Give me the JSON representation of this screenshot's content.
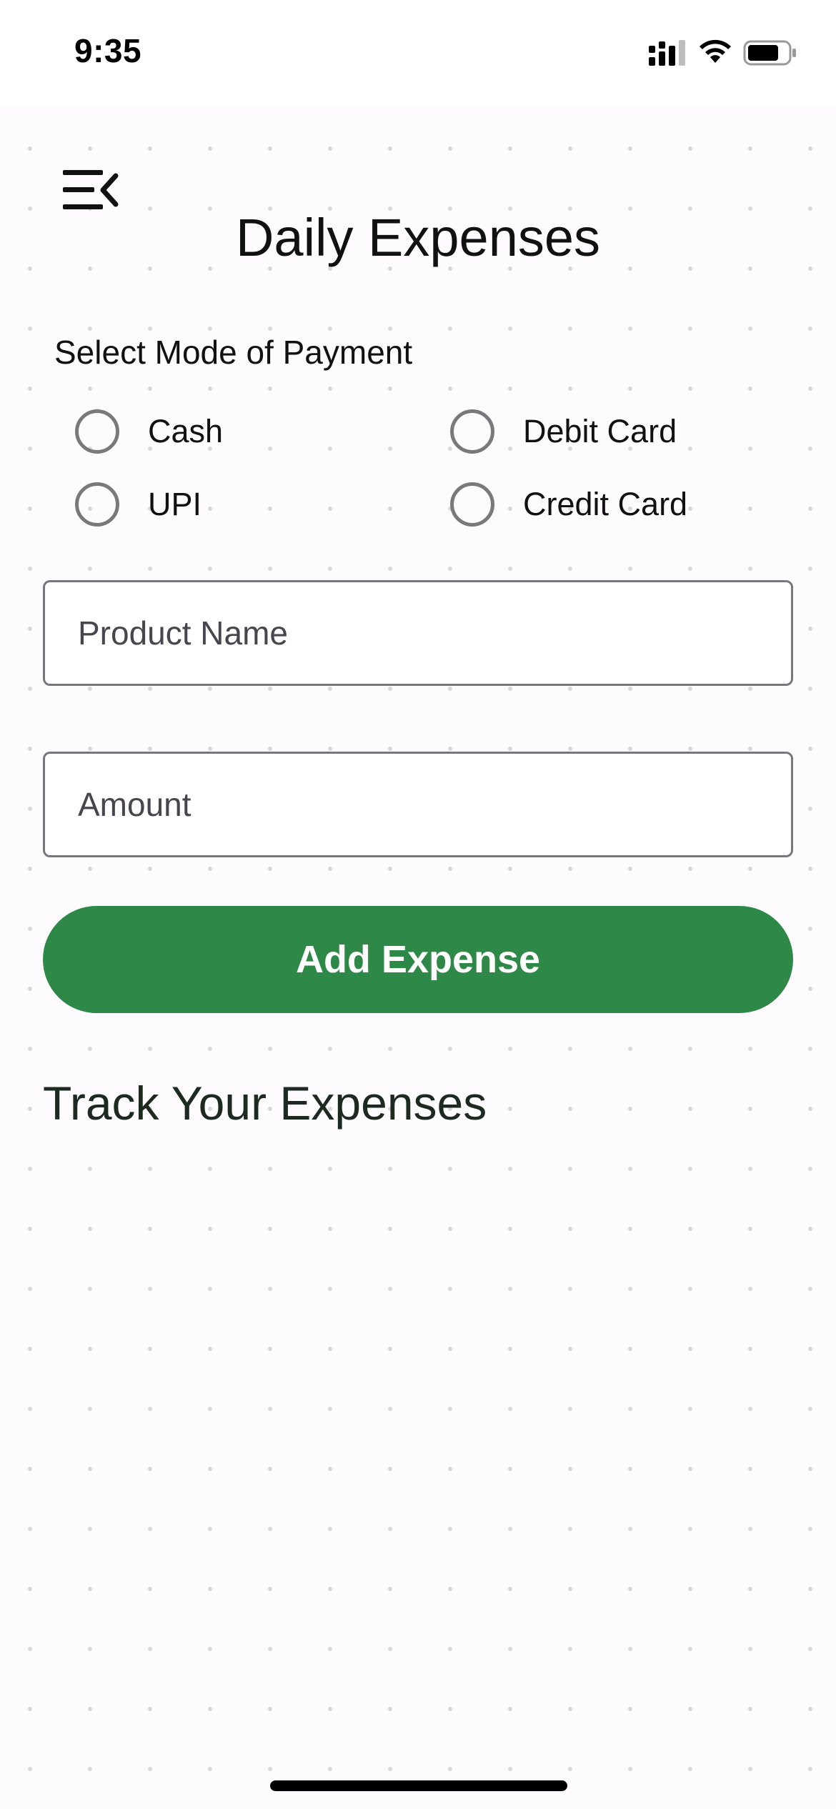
{
  "status_bar": {
    "time": "9:35",
    "icons": [
      "signal-icon",
      "wifi-icon",
      "battery-icon"
    ]
  },
  "header": {
    "menu_icon": "menu-collapse-icon",
    "title": "Daily Expenses"
  },
  "payment": {
    "label": "Select Mode of Payment",
    "options": [
      {
        "label": "Cash",
        "selected": false
      },
      {
        "label": "Debit Card",
        "selected": false
      },
      {
        "label": "UPI",
        "selected": false
      },
      {
        "label": "Credit Card",
        "selected": false
      }
    ]
  },
  "form": {
    "product_name": {
      "value": "",
      "placeholder": "Product Name"
    },
    "amount": {
      "value": "",
      "placeholder": "Amount"
    },
    "add_button_label": "Add Expense"
  },
  "expenses": {
    "title": "Track Your Expenses"
  },
  "colors": {
    "primary": "#2e8847",
    "background": "#fdfbfe",
    "radio_border": "#7a787c",
    "input_border": "#79767d"
  }
}
